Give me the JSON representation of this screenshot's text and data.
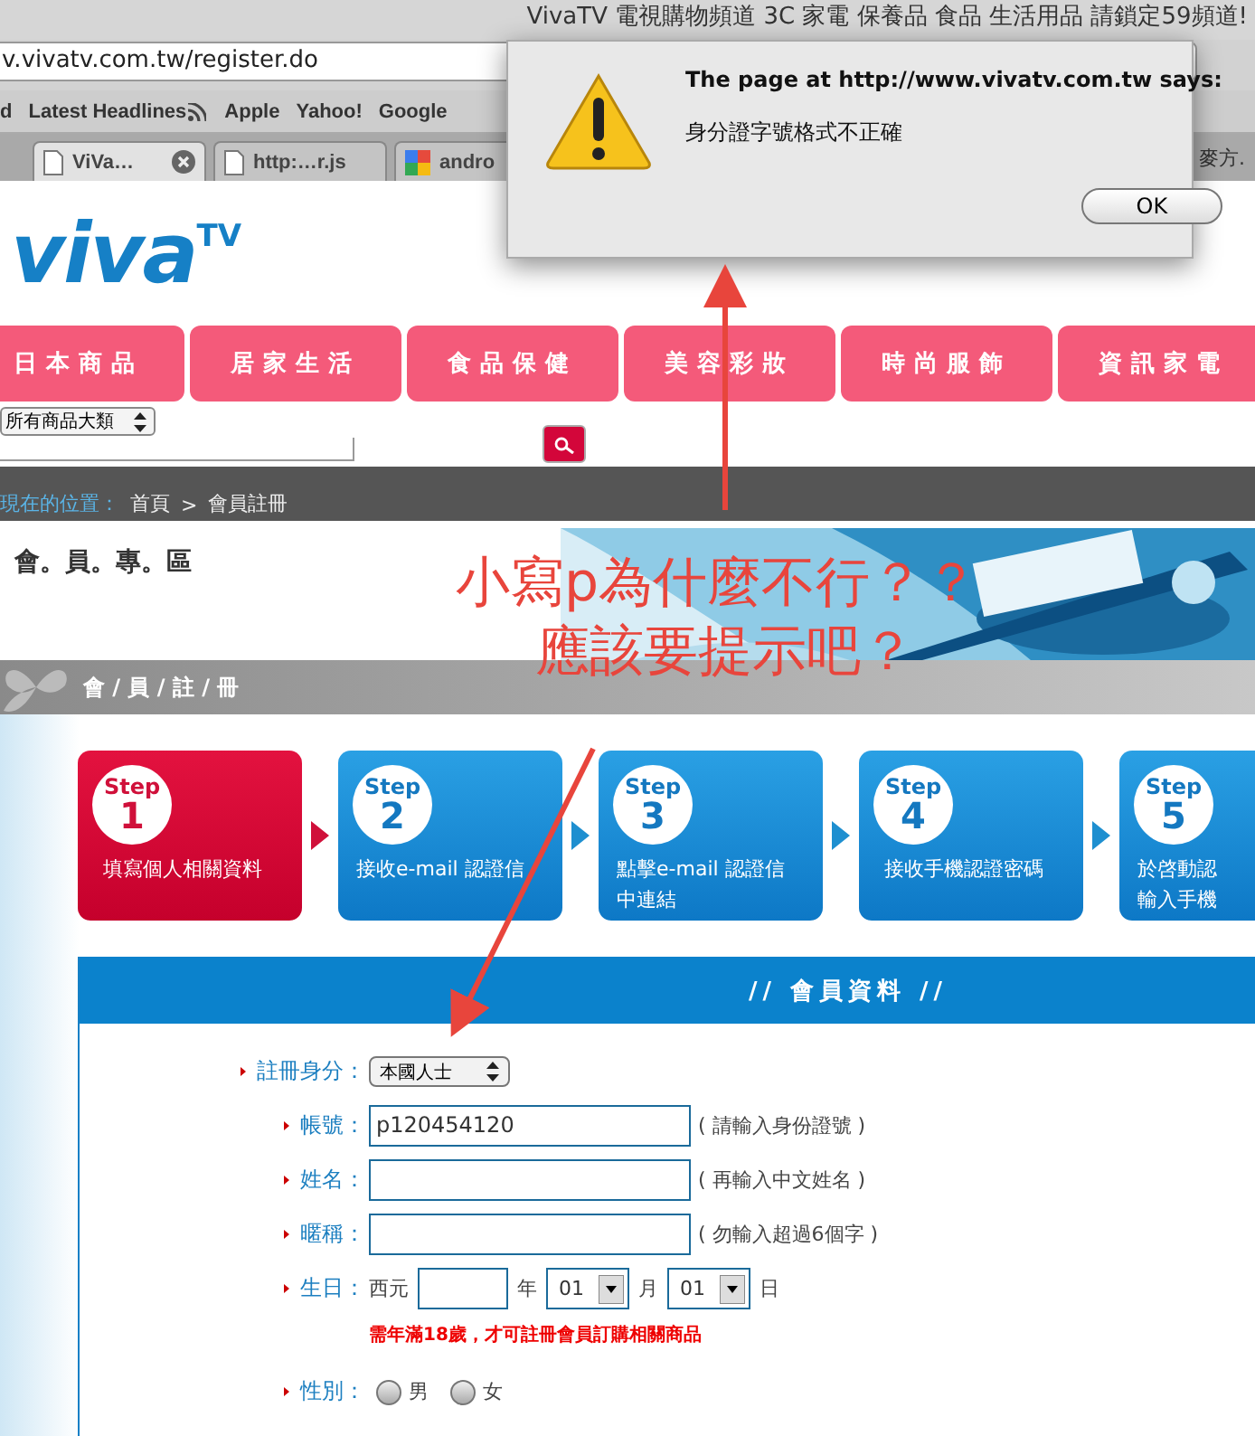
{
  "browser": {
    "headline": "VivaTV 電視購物頻道 3C 家電 保養品 食品 生活用品 請鎖定59頻道!",
    "address": "v.vivatv.com.tw/register.do",
    "bookmarks": [
      {
        "label": "d",
        "kind": "plain"
      },
      {
        "label": "Latest Headlines",
        "kind": "feed"
      },
      {
        "label": "Apple",
        "kind": "plain"
      },
      {
        "label": "Yahoo!",
        "kind": "plain"
      },
      {
        "label": "Google",
        "kind": "plain"
      }
    ],
    "tabs": [
      {
        "label": "ViVa…",
        "kind": "page",
        "selected": true
      },
      {
        "label": "http:…r.js",
        "kind": "page",
        "selected": false
      },
      {
        "label": "andro",
        "kind": "google",
        "selected": false
      }
    ],
    "tab_overflow": "麥方."
  },
  "page": {
    "logo": {
      "text": "viva",
      "suffix": "TV"
    },
    "nav": [
      "日本商品",
      "居家生活",
      "食品保健",
      "美容彩妝",
      "時尚服飾",
      "資訊家電"
    ],
    "category_select": "所有商品大類",
    "breadcrumb": {
      "label": "現在的位置：",
      "items": [
        "首頁",
        ">",
        "會員註冊"
      ]
    },
    "section_title": "會。員。專。區",
    "section_bar": "會 / 員 / 註 / 冊",
    "steps": [
      {
        "step": "Step",
        "number": "1",
        "lines": [
          "填寫個人相關資料"
        ],
        "selected": true
      },
      {
        "step": "Step",
        "number": "2",
        "lines": [
          "接收e-mail 認證信"
        ],
        "selected": false
      },
      {
        "step": "Step",
        "number": "3",
        "lines": [
          "點擊e-mail 認證信",
          "中連結"
        ],
        "selected": false
      },
      {
        "step": "Step",
        "number": "4",
        "lines": [
          "接收手機認證密碼"
        ],
        "selected": false
      },
      {
        "step": "Step",
        "number": "5",
        "lines": [
          "於啓動認",
          "輸入手機"
        ],
        "selected": false
      }
    ],
    "form": {
      "title": "// 會員資料 //",
      "rows": [
        {
          "kind": "select",
          "label": "註冊身分：",
          "value": "本國人士"
        },
        {
          "kind": "input",
          "label": "帳號：",
          "value": "p120454120",
          "hint": "( 請輸入身份證號 )"
        },
        {
          "kind": "input",
          "label": "姓名：",
          "hint": "( 再輸入中文姓名 )"
        },
        {
          "kind": "input",
          "label": "暱稱：",
          "hint": "( 勿輸入超過6個字 )"
        },
        {
          "kind": "birthday",
          "label": "生日：",
          "era": "西元",
          "year_unit": "年",
          "month": "01",
          "month_unit": "月",
          "day": "01",
          "day_unit": "日",
          "note": "需年滿18歲，才可註冊會員訂購相關商品"
        },
        {
          "kind": "radio",
          "label": "性別：",
          "options": [
            {
              "label": "男",
              "selected": false
            },
            {
              "label": "女",
              "selected": false
            }
          ]
        }
      ]
    }
  },
  "dialog": {
    "title": "The page at http://www.vivatv.com.tw says:",
    "message": "身分證字號格式不正確",
    "button": "OK"
  },
  "annotations": [
    "小寫p為什麼不行？？",
    "應該要提示吧？"
  ]
}
